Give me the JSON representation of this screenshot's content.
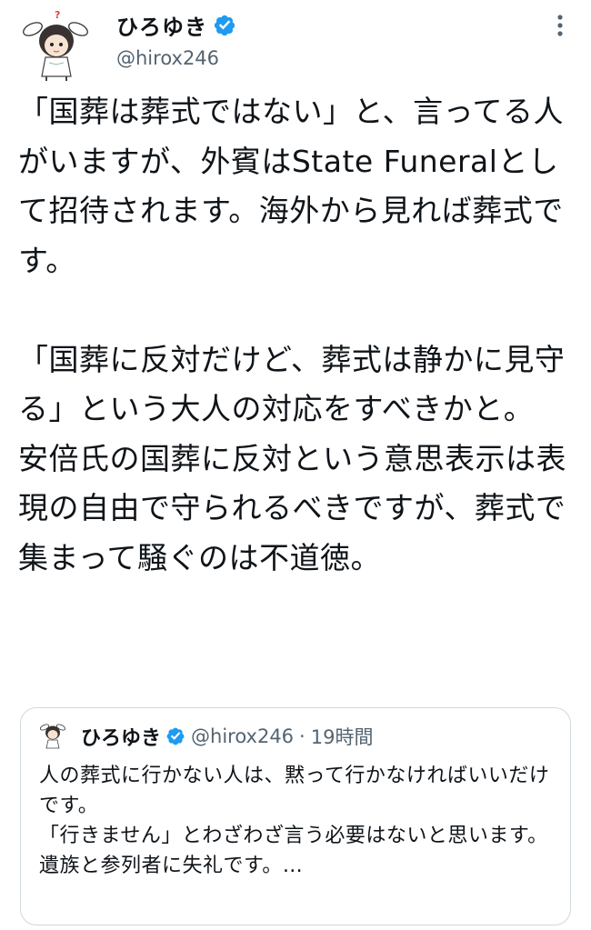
{
  "author": {
    "display_name": "ひろゆき",
    "handle": "@hirox246"
  },
  "tweet": {
    "paragraphs": [
      "「国葬は葬式ではない」と、言ってる人がいますが、外賓はState Funeralとして招待されます。海外から見れば葬式です。",
      "",
      "「国葬に反対だけど、葬式は静かに見守る」という大人の対応をすべきかと。",
      "安倍氏の国葬に反対という意思表示は表現の自由で守られるべきですが、葬式で集まって騒ぐのは不道徳。"
    ]
  },
  "quote": {
    "display_name": "ひろゆき",
    "handle": "@hirox246",
    "separator": "·",
    "time": "19時間",
    "lines": [
      "人の葬式に行かない人は、黙って行かなければいいだけです。",
      "「行きません」とわざわざ言う必要はないと思います。",
      "遺族と参列者に失礼です。…"
    ]
  },
  "colors": {
    "verified_blue": "#1d9bf0",
    "secondary_text": "#536471",
    "border": "#cfd9de"
  },
  "icons": {
    "verified": "verified-badge-icon",
    "more": "more-vertical-icon"
  }
}
